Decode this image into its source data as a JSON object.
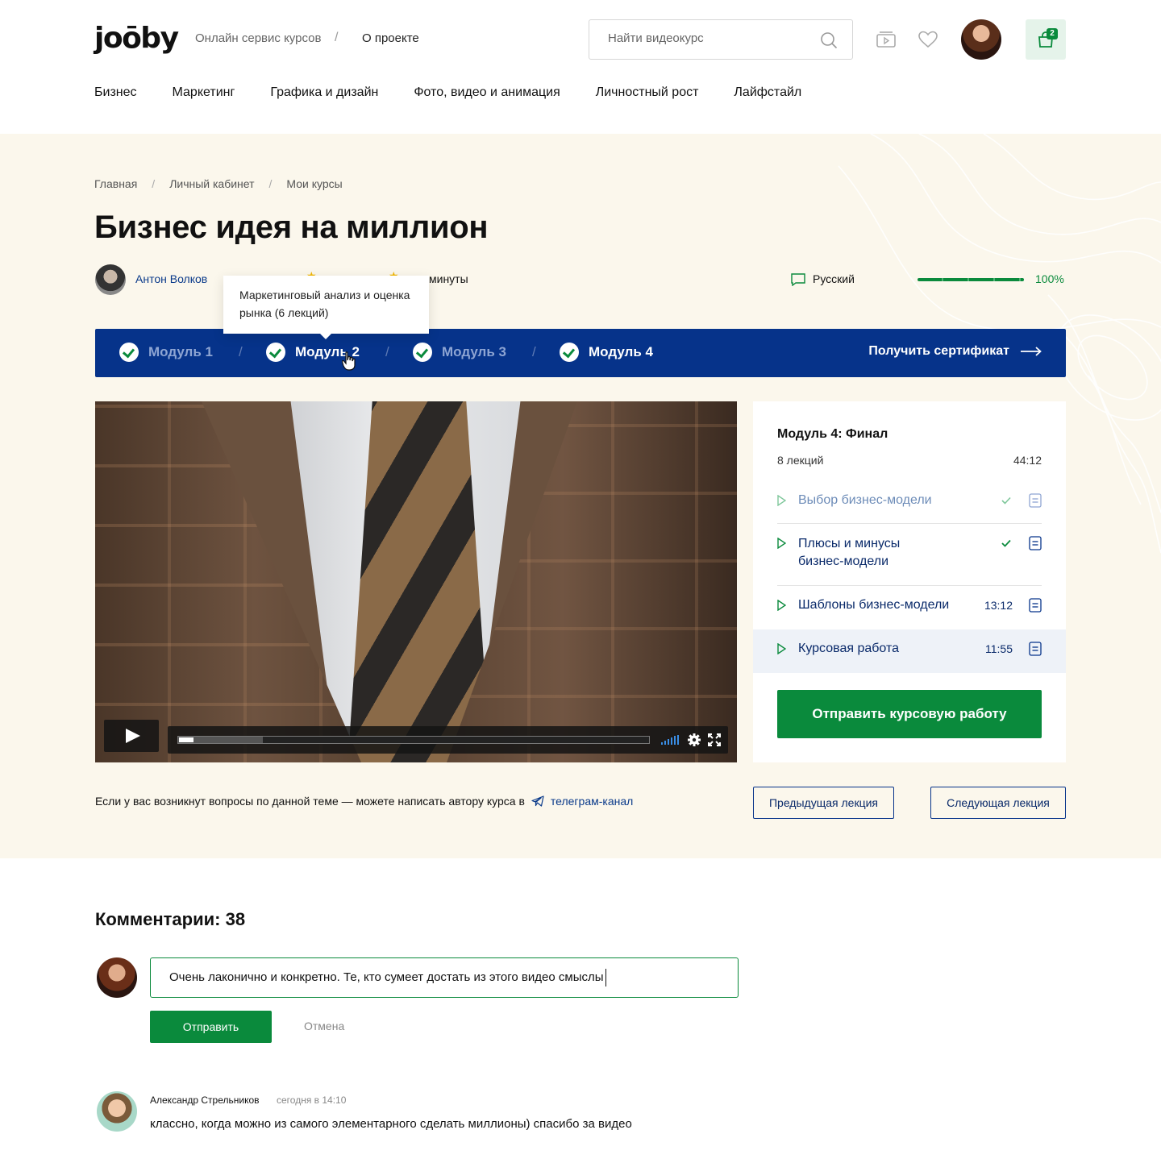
{
  "header": {
    "logo": "joōby",
    "tagline": "Онлайн сервис курсов",
    "about": "О проекте",
    "search_placeholder": "Найти видеокурс",
    "cart_count": "2",
    "nav": [
      "Бизнес",
      "Маркетинг",
      "Графика и дизайн",
      "Фото, видео и анимация",
      "Личностный рост",
      "Лайфстайл"
    ]
  },
  "breadcrumbs": [
    "Главная",
    "Личный кабинет",
    "Мои курсы"
  ],
  "course": {
    "title": "Бизнес идея на миллион",
    "author": "Антон Волков",
    "duration_fragment": "минуты",
    "language": "Русский",
    "progress_label": "100%",
    "progress_fraction": 1.0
  },
  "tooltip": "Маркетинговый анализ и оценка рынка (6 лекций)",
  "modules": [
    {
      "label": "Модуль 1",
      "state": "dim"
    },
    {
      "label": "Модуль 2",
      "state": "bright"
    },
    {
      "label": "Модуль 3",
      "state": "dim"
    },
    {
      "label": "Модуль 4",
      "state": "bright"
    }
  ],
  "certificate_label": "Получить сертификат",
  "player": {
    "progress_fraction": 0.03,
    "buffered_fraction": 0.18
  },
  "panel": {
    "title": "Модуль 4: Финал",
    "count": "8 лекций",
    "total": "44:12",
    "lessons": [
      {
        "name": "Выбор бизнес-модели",
        "time": "",
        "done": true,
        "active": false
      },
      {
        "name": "Плюсы и минусы бизнес-модели",
        "time": "",
        "done": true,
        "active": false
      },
      {
        "name": "Шаблоны бизнес-модели",
        "time": "13:12",
        "done": false,
        "active": false
      },
      {
        "name": "Курсовая работа",
        "time": "11:55",
        "done": false,
        "active": true
      }
    ],
    "submit_label": "Отправить курсовую работу"
  },
  "help": {
    "text": "Если у вас возникнут вопросы по данной теме — можете написать автору курса в",
    "link": "телеграм-канал"
  },
  "prev_label": "Предыдущая лекция",
  "next_label": "Следующая лекция",
  "comments": {
    "title": "Комментарии: 38",
    "draft": "Очень лаконично и конкретно. Те, кто сумеет достать из этого видео смыслы",
    "send_label": "Отправить",
    "cancel_label": "Отмена",
    "items": [
      {
        "author": "Александр Стрельников",
        "time": "сегодня в 14:10",
        "text": "классно, когда можно из самого элементарного сделать миллионы) спасибо за видео"
      }
    ]
  },
  "colors": {
    "brand_blue": "#06338a",
    "brand_green": "#0a8a3c",
    "hero_bg": "#fbf7ec"
  }
}
